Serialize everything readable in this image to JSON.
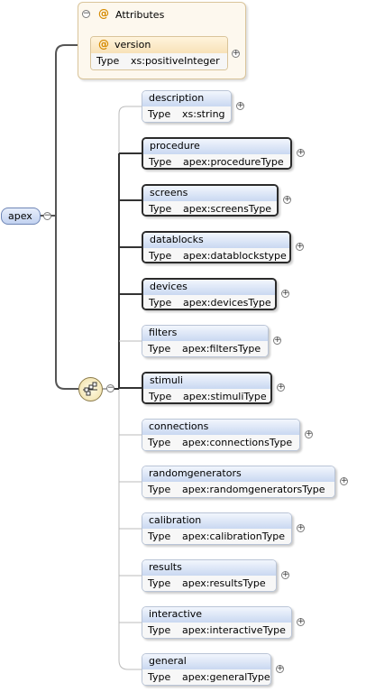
{
  "root": {
    "label": "apex"
  },
  "attributes": {
    "header": "Attributes",
    "items": [
      {
        "name": "version",
        "type_label": "Type",
        "type": "xs:positiveInteger"
      }
    ]
  },
  "elements": [
    {
      "name": "description",
      "type_label": "Type",
      "type": "xs:string",
      "required": false
    },
    {
      "name": "procedure",
      "type_label": "Type",
      "type": "apex:procedureType",
      "required": true
    },
    {
      "name": "screens",
      "type_label": "Type",
      "type": "apex:screensType",
      "required": true
    },
    {
      "name": "datablocks",
      "type_label": "Type",
      "type": "apex:datablockstype",
      "required": true
    },
    {
      "name": "devices",
      "type_label": "Type",
      "type": "apex:devicesType",
      "required": true
    },
    {
      "name": "filters",
      "type_label": "Type",
      "type": "apex:filtersType",
      "required": false
    },
    {
      "name": "stimuli",
      "type_label": "Type",
      "type": "apex:stimuliType",
      "required": true
    },
    {
      "name": "connections",
      "type_label": "Type",
      "type": "apex:connectionsType",
      "required": false
    },
    {
      "name": "randomgenerators",
      "type_label": "Type",
      "type": "apex:randomgeneratorsType",
      "required": false
    },
    {
      "name": "calibration",
      "type_label": "Type",
      "type": "apex:calibrationType",
      "required": false
    },
    {
      "name": "results",
      "type_label": "Type",
      "type": "apex:resultsType",
      "required": false
    },
    {
      "name": "interactive",
      "type_label": "Type",
      "type": "apex:interactiveType",
      "required": false
    },
    {
      "name": "general",
      "type_label": "Type",
      "type": "apex:generalType",
      "required": false
    }
  ]
}
